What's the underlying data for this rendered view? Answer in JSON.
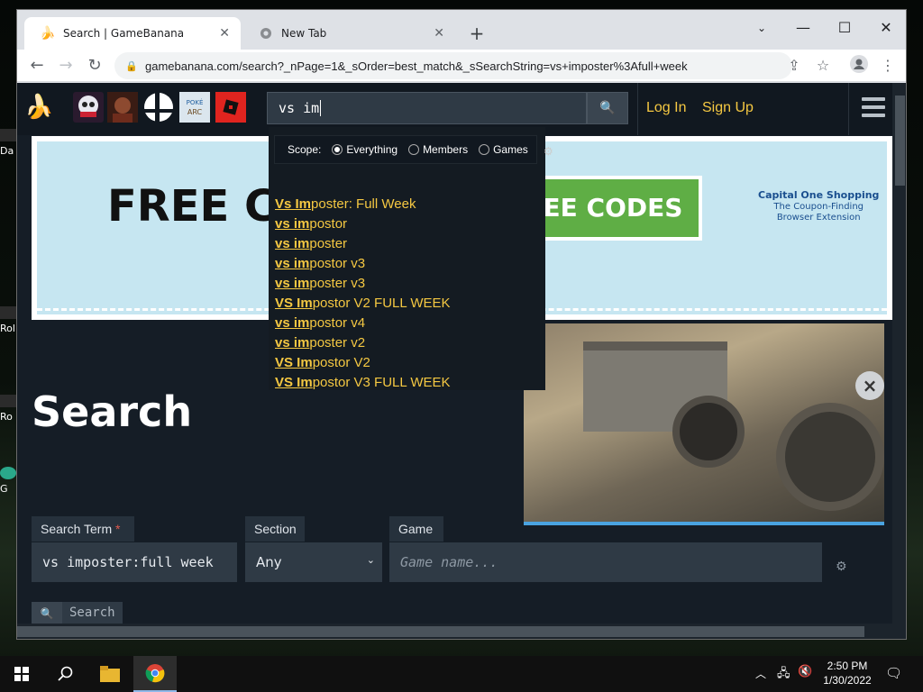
{
  "desktop": {
    "icons": [
      {
        "label": "Da"
      },
      {
        "label": "Rol"
      },
      {
        "label": "Ro"
      },
      {
        "label": "G"
      }
    ]
  },
  "browser": {
    "tabs": [
      {
        "title": "Search | GameBanana",
        "icon": "banana-icon",
        "active": true
      },
      {
        "title": "New Tab",
        "icon": "chrome-icon",
        "active": false
      }
    ],
    "url": "gamebanana.com/search?_nPage=1&_sOrder=best_match&_sSearchString=vs+imposter%3Afull+week"
  },
  "site": {
    "header": {
      "search_value": "vs im",
      "login": "Log In",
      "signup": "Sign Up"
    },
    "ad": {
      "headline": "FREE CO",
      "button": "EE CODES",
      "brand": "Capital One Shopping",
      "tagline1": "The Coupon-Finding",
      "tagline2": "Browser Extension"
    },
    "dropdown": {
      "scope_label": "Scope:",
      "scope_options": [
        "Everything",
        "Members",
        "Games"
      ],
      "scope_selected": "Everything",
      "suggestions": [
        {
          "match": "Vs Im",
          "rest": "poster: Full Week"
        },
        {
          "match": "vs im",
          "rest": "postor"
        },
        {
          "match": "vs im",
          "rest": "poster"
        },
        {
          "match": "vs im",
          "rest": "postor v3"
        },
        {
          "match": "vs im",
          "rest": "poster v3"
        },
        {
          "match": "VS Im",
          "rest": "postor V2 FULL WEEK"
        },
        {
          "match": "vs im",
          "rest": "postor v4"
        },
        {
          "match": "vs im",
          "rest": "poster v2"
        },
        {
          "match": "VS Im",
          "rest": "postor V2"
        },
        {
          "match": "VS Im",
          "rest": "postor V3 FULL WEEK"
        }
      ]
    },
    "page_title": "Search",
    "form": {
      "term_label": "Search Term",
      "term_required": "*",
      "term_value": "vs imposter:full week",
      "section_label": "Section",
      "section_value": "Any",
      "game_label": "Game",
      "game_placeholder": "Game name...",
      "search_button": "Search"
    }
  },
  "taskbar": {
    "time": "2:50 PM",
    "date": "1/30/2022"
  },
  "colors": {
    "link": "#f5c842",
    "page_bg": "#151d26",
    "ad_bg": "#c6e6f1",
    "ad_button": "#5fae45"
  }
}
